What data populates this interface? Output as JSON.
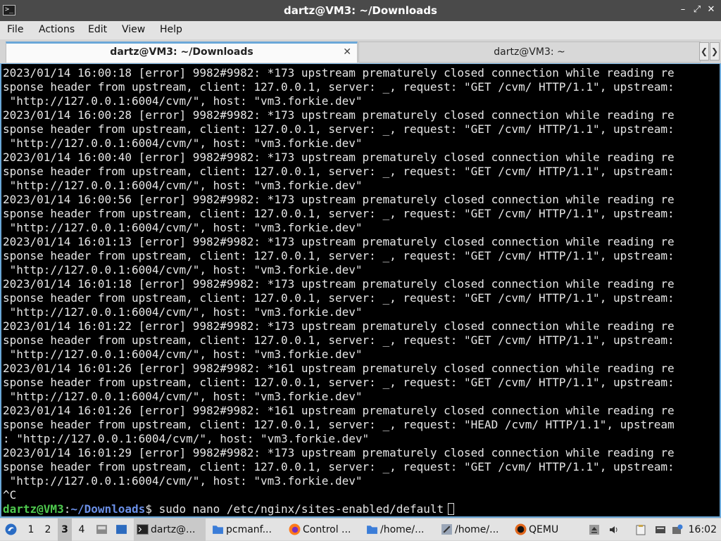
{
  "window": {
    "title": "dartz@VM3: ~/Downloads"
  },
  "menu": [
    "File",
    "Actions",
    "Edit",
    "View",
    "Help"
  ],
  "tabs": [
    {
      "label": "dartz@VM3: ~/Downloads",
      "active": true
    },
    {
      "label": "dartz@VM3: ~",
      "active": false
    }
  ],
  "terminal": {
    "lines": [
      "2023/01/14 16:00:18 [error] 9982#9982: *173 upstream prematurely closed connection while reading re",
      "sponse header from upstream, client: 127.0.0.1, server: _, request: \"GET /cvm/ HTTP/1.1\", upstream:",
      " \"http://127.0.0.1:6004/cvm/\", host: \"vm3.forkie.dev\"",
      "2023/01/14 16:00:28 [error] 9982#9982: *173 upstream prematurely closed connection while reading re",
      "sponse header from upstream, client: 127.0.0.1, server: _, request: \"GET /cvm/ HTTP/1.1\", upstream:",
      " \"http://127.0.0.1:6004/cvm/\", host: \"vm3.forkie.dev\"",
      "2023/01/14 16:00:40 [error] 9982#9982: *173 upstream prematurely closed connection while reading re",
      "sponse header from upstream, client: 127.0.0.1, server: _, request: \"GET /cvm/ HTTP/1.1\", upstream:",
      " \"http://127.0.0.1:6004/cvm/\", host: \"vm3.forkie.dev\"",
      "2023/01/14 16:00:56 [error] 9982#9982: *173 upstream prematurely closed connection while reading re",
      "sponse header from upstream, client: 127.0.0.1, server: _, request: \"GET /cvm/ HTTP/1.1\", upstream:",
      " \"http://127.0.0.1:6004/cvm/\", host: \"vm3.forkie.dev\"",
      "2023/01/14 16:01:13 [error] 9982#9982: *173 upstream prematurely closed connection while reading re",
      "sponse header from upstream, client: 127.0.0.1, server: _, request: \"GET /cvm/ HTTP/1.1\", upstream:",
      " \"http://127.0.0.1:6004/cvm/\", host: \"vm3.forkie.dev\"",
      "2023/01/14 16:01:18 [error] 9982#9982: *173 upstream prematurely closed connection while reading re",
      "sponse header from upstream, client: 127.0.0.1, server: _, request: \"GET /cvm/ HTTP/1.1\", upstream:",
      " \"http://127.0.0.1:6004/cvm/\", host: \"vm3.forkie.dev\"",
      "2023/01/14 16:01:22 [error] 9982#9982: *173 upstream prematurely closed connection while reading re",
      "sponse header from upstream, client: 127.0.0.1, server: _, request: \"GET /cvm/ HTTP/1.1\", upstream:",
      " \"http://127.0.0.1:6004/cvm/\", host: \"vm3.forkie.dev\"",
      "2023/01/14 16:01:26 [error] 9982#9982: *161 upstream prematurely closed connection while reading re",
      "sponse header from upstream, client: 127.0.0.1, server: _, request: \"GET /cvm/ HTTP/1.1\", upstream:",
      " \"http://127.0.0.1:6004/cvm/\", host: \"vm3.forkie.dev\"",
      "2023/01/14 16:01:26 [error] 9982#9982: *161 upstream prematurely closed connection while reading re",
      "sponse header from upstream, client: 127.0.0.1, server: _, request: \"HEAD /cvm/ HTTP/1.1\", upstream",
      ": \"http://127.0.0.1:6004/cvm/\", host: \"vm3.forkie.dev\"",
      "2023/01/14 16:01:29 [error] 9982#9982: *173 upstream prematurely closed connection while reading re",
      "sponse header from upstream, client: 127.0.0.1, server: _, request: \"GET /cvm/ HTTP/1.1\", upstream:",
      " \"http://127.0.0.1:6004/cvm/\", host: \"vm3.forkie.dev\"",
      "^C"
    ],
    "prompt": {
      "user_host": "dartz@VM3",
      "separator": ":",
      "path": "~/Downloads",
      "symbol": "$",
      "command": " sudo nano /etc/nginx/sites-enabled/default"
    }
  },
  "taskbar": {
    "desktops": [
      "1",
      "2",
      "3",
      "4"
    ],
    "current_desktop": "3",
    "tasks": [
      {
        "label": "dartz@...",
        "icon": "terminal-icon",
        "active": true
      },
      {
        "label": "pcmanf...",
        "icon": "folder-icon",
        "active": false
      },
      {
        "label": "Control ...",
        "icon": "firefox-icon",
        "active": false
      },
      {
        "label": "/home/...",
        "icon": "folder-icon",
        "active": false
      },
      {
        "label": "/home/...",
        "icon": "text-editor-icon",
        "active": false
      },
      {
        "label": "QEMU",
        "icon": "qemu-icon",
        "active": false
      }
    ],
    "clock": "16:02"
  },
  "colors": {
    "prompt_user": "#4ec94e",
    "prompt_path": "#6a8fe6",
    "terminal_bg": "#000000",
    "terminal_fg": "#e6e6e6",
    "accent": "#6aa7d8"
  }
}
